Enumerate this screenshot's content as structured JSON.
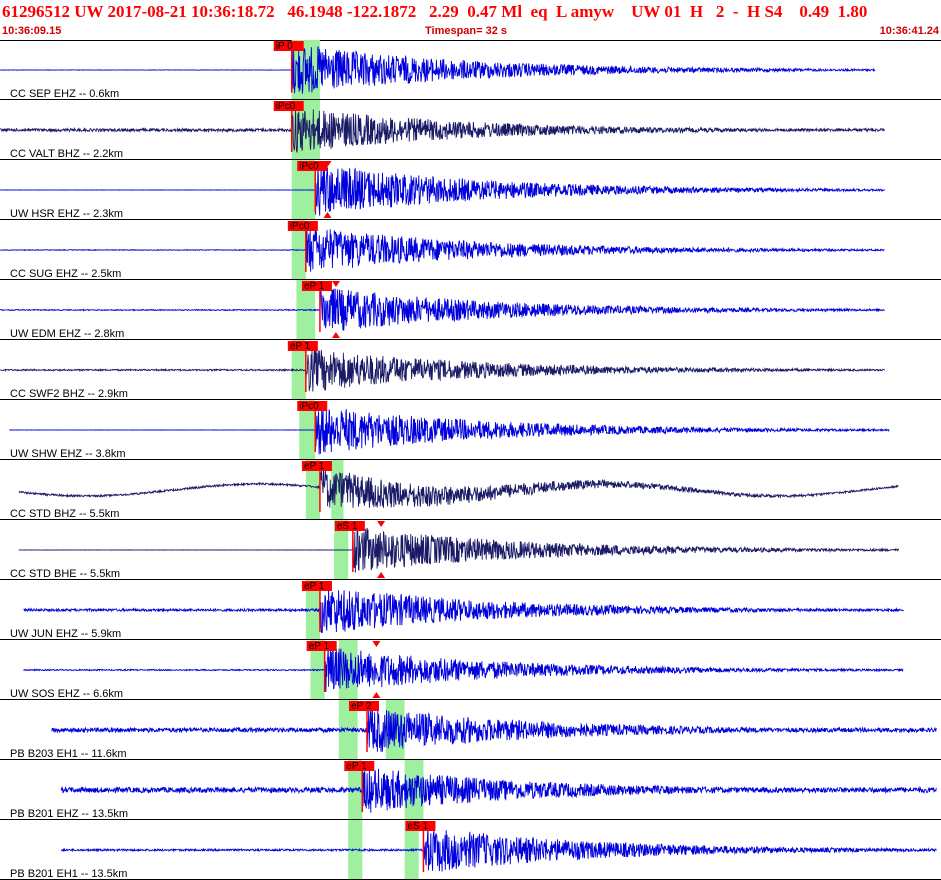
{
  "header": {
    "event_line": "61296512 UW 2017-08-21 10:36:18.72   46.1948 -122.1872   2.29  0.47 Ml  eq  L amyw    UW 01  H   2  -  H S4    0.49  1.80",
    "start_time": "10:36:09.15",
    "timespan": "Timespan=  32 s",
    "end_time": "10:36:41.24"
  },
  "colors": {
    "header_text": "#ff0000",
    "trace_blue": "#0000dd",
    "trace_dark": "#1a1a66",
    "pick_red": "#ff0000",
    "window_green": "#9ef09e"
  },
  "traces": [
    {
      "label": "CC SEP EHZ -- 0.6km",
      "pick": "iP 0",
      "color": "#0000dd",
      "start": 0.0,
      "end": 0.93,
      "onset": 0.31,
      "amp": 0.45,
      "noise": 0.02,
      "green": [
        [
          0.31,
          0.34
        ]
      ],
      "ticks": []
    },
    {
      "label": "CC VALT BHZ -- 2.2km",
      "pick": "iPc0",
      "color": "#1a1a66",
      "start": 0.0,
      "end": 0.94,
      "onset": 0.31,
      "amp": 0.4,
      "noise": 0.12,
      "green": [
        [
          0.31,
          0.34
        ]
      ],
      "ticks": []
    },
    {
      "label": "UW HSR EHZ -- 2.3km",
      "pick": "iPc0",
      "color": "#0000dd",
      "start": 0.0,
      "end": 0.94,
      "onset": 0.335,
      "amp": 0.45,
      "noise": 0.01,
      "green": [
        [
          0.31,
          0.335
        ]
      ],
      "ticks": [
        0.348
      ]
    },
    {
      "label": "CC SUG EHZ -- 2.5km",
      "pick": "iPc0",
      "color": "#0000dd",
      "start": 0.0,
      "end": 0.94,
      "onset": 0.325,
      "amp": 0.4,
      "noise": 0.03,
      "green": [
        [
          0.31,
          0.325
        ]
      ],
      "ticks": []
    },
    {
      "label": "UW EDM EHZ -- 2.8km",
      "pick": "eP 1",
      "color": "#0000dd",
      "start": 0.0,
      "end": 0.94,
      "onset": 0.34,
      "amp": 0.4,
      "noise": 0.04,
      "green": [
        [
          0.315,
          0.335
        ]
      ],
      "ticks": [
        0.357
      ]
    },
    {
      "label": "CC SWF2 BHZ -- 2.9km",
      "pick": "eP 1",
      "color": "#1a1a66",
      "start": 0.0,
      "end": 0.94,
      "onset": 0.325,
      "amp": 0.38,
      "noise": 0.06,
      "green": [
        [
          0.31,
          0.325
        ]
      ],
      "ticks": []
    },
    {
      "label": "UW SHW EHZ -- 3.8km",
      "pick": "iPc0",
      "color": "#0000dd",
      "start": 0.01,
      "end": 0.945,
      "onset": 0.335,
      "amp": 0.42,
      "noise": 0.01,
      "green": [
        [
          0.318,
          0.335
        ]
      ],
      "ticks": []
    },
    {
      "label": "CC STD BHZ -- 5.5km",
      "pick": "eP 1",
      "color": "#1a1a66",
      "start": 0.02,
      "end": 0.955,
      "onset": 0.34,
      "amp": 0.35,
      "noise": 0.08,
      "green": [
        [
          0.325,
          0.34
        ],
        [
          0.352,
          0.365
        ]
      ],
      "ticks": []
    },
    {
      "label": "CC STD BHE -- 5.5km",
      "pick": "eS 1",
      "color": "#1a1a66",
      "start": 0.02,
      "end": 0.955,
      "onset": 0.375,
      "amp": 0.4,
      "noise": 0.01,
      "green": [
        [
          0.355,
          0.37
        ]
      ],
      "ticks": [
        0.405
      ]
    },
    {
      "label": "UW JUN EHZ -- 5.9km",
      "pick": "eP 1",
      "color": "#0000dd",
      "start": 0.025,
      "end": 0.96,
      "onset": 0.34,
      "amp": 0.42,
      "noise": 0.1,
      "green": [
        [
          0.325,
          0.34
        ]
      ],
      "ticks": []
    },
    {
      "label": "UW SOS EHZ -- 6.6km",
      "pick": "eP 1",
      "color": "#0000dd",
      "start": 0.025,
      "end": 0.96,
      "onset": 0.345,
      "amp": 0.4,
      "noise": 0.05,
      "green": [
        [
          0.33,
          0.345
        ],
        [
          0.36,
          0.38
        ]
      ],
      "ticks": [
        0.4
      ]
    },
    {
      "label": "PB B203 EH1 -- 11.6km",
      "pick": "eP 2",
      "color": "#0000dd",
      "start": 0.055,
      "end": 0.995,
      "onset": 0.39,
      "amp": 0.4,
      "noise": 0.18,
      "green": [
        [
          0.36,
          0.38
        ],
        [
          0.41,
          0.43
        ]
      ],
      "ticks": []
    },
    {
      "label": "PB B201 EHZ -- 13.5km",
      "pick": "eP 1",
      "color": "#0000dd",
      "start": 0.065,
      "end": 0.995,
      "onset": 0.385,
      "amp": 0.4,
      "noise": 0.22,
      "green": [
        [
          0.37,
          0.385
        ],
        [
          0.43,
          0.45
        ]
      ],
      "ticks": []
    },
    {
      "label": "PB B201 EH1 -- 13.5km",
      "pick": "eS 1",
      "color": "#0000dd",
      "start": 0.065,
      "end": 0.995,
      "onset": 0.45,
      "amp": 0.4,
      "noise": 0.08,
      "green": [
        [
          0.37,
          0.385
        ],
        [
          0.43,
          0.445
        ]
      ],
      "ticks": []
    }
  ]
}
